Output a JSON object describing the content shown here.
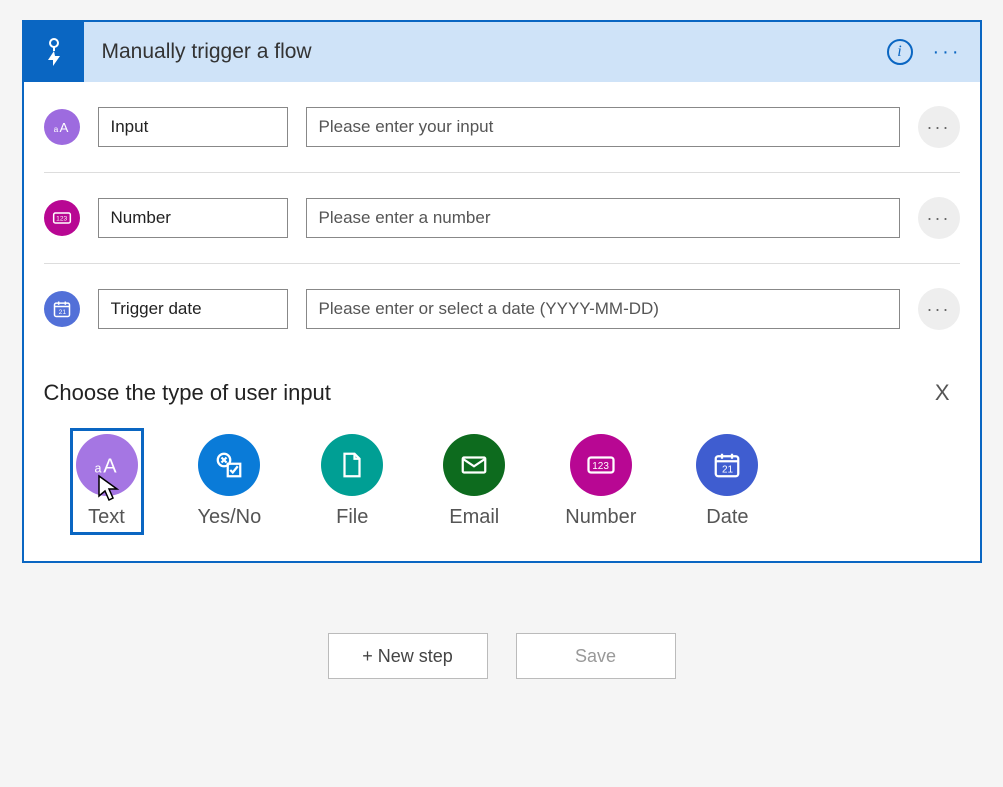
{
  "header": {
    "title": "Manually trigger a flow"
  },
  "inputs": [
    {
      "name": "Input",
      "placeholder": "Please enter your input",
      "iconClass": "bg-purple",
      "iconType": "text"
    },
    {
      "name": "Number",
      "placeholder": "Please enter a number",
      "iconClass": "bg-magenta",
      "iconType": "number"
    },
    {
      "name": "Trigger date",
      "placeholder": "Please enter or select a date (YYYY-MM-DD)",
      "iconClass": "bg-blue",
      "iconType": "date"
    }
  ],
  "typeSection": {
    "heading": "Choose the type of user input",
    "close": "X",
    "options": [
      {
        "label": "Text",
        "selected": true,
        "color": "c-purple",
        "icon": "text"
      },
      {
        "label": "Yes/No",
        "selected": false,
        "color": "c-blue",
        "icon": "yesno"
      },
      {
        "label": "File",
        "selected": false,
        "color": "c-teal",
        "icon": "file"
      },
      {
        "label": "Email",
        "selected": false,
        "color": "c-green",
        "icon": "email"
      },
      {
        "label": "Number",
        "selected": false,
        "color": "c-magenta",
        "icon": "number"
      },
      {
        "label": "Date",
        "selected": false,
        "color": "c-indigo",
        "icon": "date"
      }
    ]
  },
  "footer": {
    "newStep": "+ New step",
    "save": "Save"
  }
}
